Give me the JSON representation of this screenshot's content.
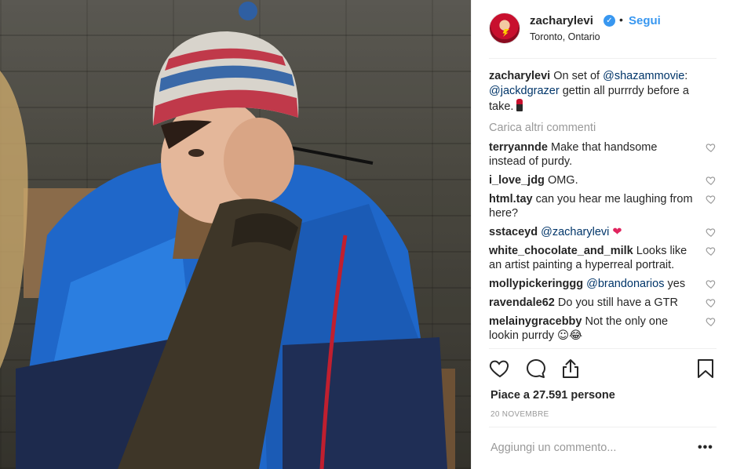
{
  "post": {
    "image_alt": "photo",
    "header": {
      "username": "zacharylevi",
      "verified_mark": "✓",
      "separator": "•",
      "follow_label": "Segui",
      "location": "Toronto, Ontario"
    },
    "caption": {
      "username": "zacharylevi",
      "text_1": "On set of",
      "mention_1": "@shazammovie",
      "text_2": ":",
      "mention_2": "@jackdgrazer",
      "text_3": "gettin all purrrdy before a take."
    },
    "load_more": "Carica altri commenti",
    "comments": [
      {
        "username": "terryannde",
        "text": "Make that handsome instead of purdy."
      },
      {
        "username": "i_love_jdg",
        "text": "OMG."
      },
      {
        "username": "html.tay",
        "text": "can you hear me laughing from here?"
      },
      {
        "username": "sstaceyd",
        "mention": "@zacharylevi",
        "text": "❤"
      },
      {
        "username": "white_chocolate_and_milk",
        "text": "Looks like an artist painting a hyperreal portrait."
      },
      {
        "username": "mollypickeringgg",
        "mention": "@brandonarios",
        "text": "yes"
      },
      {
        "username": "ravendale62",
        "text": "Do you still have a GTR"
      },
      {
        "username": "melainygracebby",
        "text": "Not the only one lookin purrdy",
        "emoji": "☺😂"
      }
    ],
    "likes_text": "Piace a 27.591 persone",
    "date": "20 NOVEMBRE",
    "add_comment_placeholder": "Aggiungi un commento...",
    "more_options": "•••"
  }
}
